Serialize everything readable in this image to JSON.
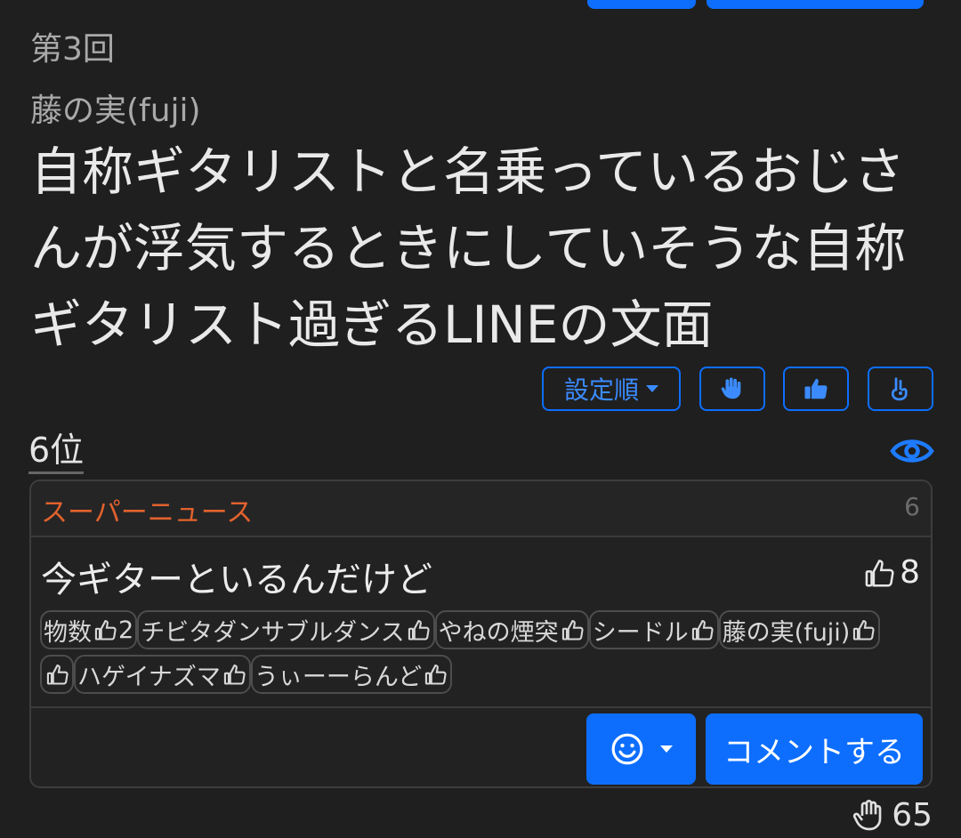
{
  "header": {
    "episode": "第3回",
    "author": "藤の実(fuji)",
    "title": "自称ギタリストと名乗っているおじさんが浮気するときにしていそうな自称ギタリスト過ぎるLINEの文面"
  },
  "controls": {
    "sort_label": "設定順",
    "icons": [
      "hand-raise-icon",
      "thumbs-up-icon",
      "hand-peace-icon"
    ],
    "accent": "#0d6efd"
  },
  "answer": {
    "rank": "6位",
    "source": "スーパーニュース",
    "number": "6",
    "text": "今ギターといるんだけど",
    "likes": "8",
    "voters_row1": [
      {
        "name": "物数",
        "count": "2"
      },
      {
        "name": "チビタダンサブルダンス",
        "count": ""
      },
      {
        "name": "やねの煙突",
        "count": ""
      },
      {
        "name": "シードル",
        "count": ""
      },
      {
        "name": "藤の実(fuji)",
        "count": ""
      }
    ],
    "voters_row2": [
      {
        "name": "",
        "count": ""
      },
      {
        "name": "ハゲイナズマ",
        "count": ""
      },
      {
        "name": "うぃーーらんど",
        "count": ""
      }
    ],
    "comment_label": "コメントする"
  },
  "footer": {
    "votes": "65"
  },
  "colors": {
    "source": "#e2622d",
    "background": "#1f1f1f"
  }
}
